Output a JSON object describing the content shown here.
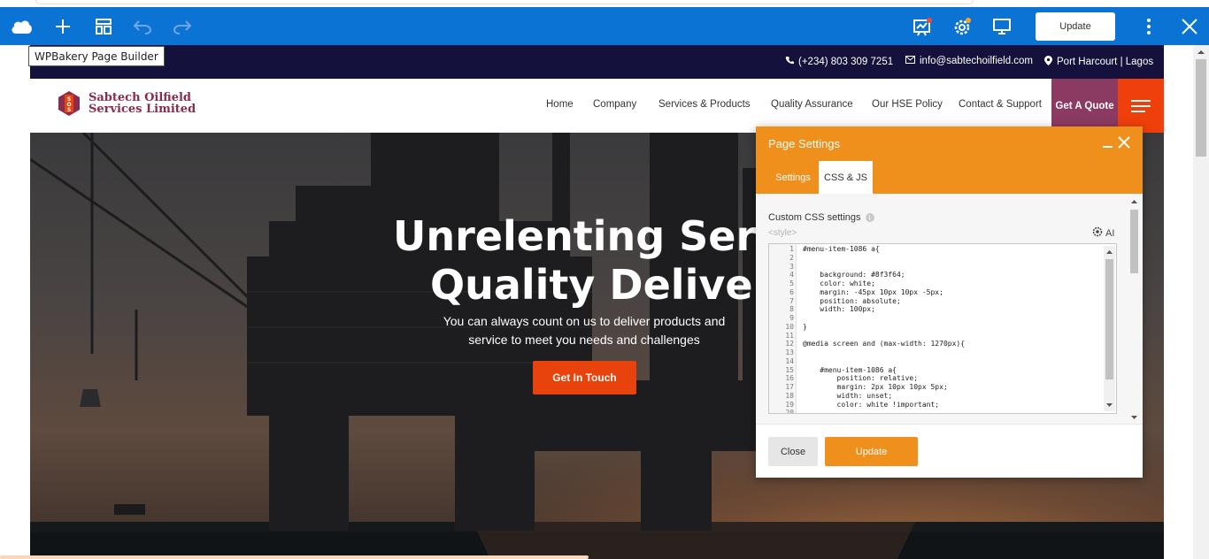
{
  "builder": {
    "tooltip": "WPBakery Page Builder",
    "update_label": "Update",
    "icons": [
      "cloud-logo-icon",
      "add-element-icon",
      "templates-icon",
      "undo-icon",
      "redo-icon",
      "seo-icon",
      "settings-icon",
      "responsive-icon",
      "more-icon",
      "close-icon"
    ]
  },
  "site": {
    "phone": "(+234) 803 309 7251",
    "email": "info@sabtechoilfield.com",
    "location": "Port Harcourt | Lagos",
    "logo_line1": "Sabtech Oilfield",
    "logo_line2": "Services Limited",
    "nav": [
      "Home",
      "Company",
      "Services & Products",
      "Quality Assurance",
      "Our HSE Policy",
      "Contact & Support"
    ],
    "quote_label": "Get A Quote",
    "hero_title_line1": "Unrelenting Servic",
    "hero_title_line2": "Quality Delivery",
    "hero_sub_line1": "You can always count on us to deliver products and",
    "hero_sub_line2": "service to meet you needs and challenges",
    "cta_label": "Get In Touch"
  },
  "panel": {
    "title": "Page Settings",
    "tab_settings": "Settings",
    "tab_css": "CSS & JS",
    "css_label": "Custom CSS settings",
    "style_tag": "<style>",
    "ai_label": "AI",
    "code_lines": [
      "#menu-item-1086 a{",
      "",
      "",
      "    background: #8f3f64;",
      "    color: white;",
      "    margin: -45px 10px 10px -5px;",
      "    position: absolute;",
      "    width: 100px;",
      "",
      "}",
      "",
      "@media screen and (max-width: 1270px){",
      "",
      "",
      "    #menu-item-1086 a{",
      "        position: relative;",
      "        margin: 2px 10px 10px 5px;",
      "        width: unset;",
      "        color: white !important;",
      ""
    ],
    "close_label": "Close",
    "update_label": "Update"
  }
}
